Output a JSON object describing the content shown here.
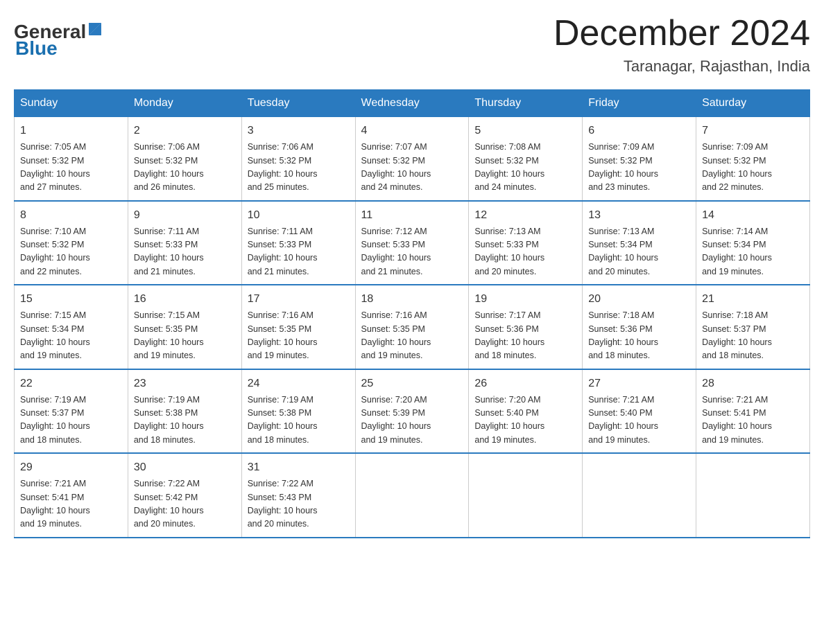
{
  "header": {
    "logo_general": "General",
    "logo_blue": "Blue",
    "month_year": "December 2024",
    "location": "Taranagar, Rajasthan, India"
  },
  "days_of_week": [
    "Sunday",
    "Monday",
    "Tuesday",
    "Wednesday",
    "Thursday",
    "Friday",
    "Saturday"
  ],
  "weeks": [
    [
      {
        "day": "1",
        "sunrise": "7:05 AM",
        "sunset": "5:32 PM",
        "daylight": "10 hours and 27 minutes."
      },
      {
        "day": "2",
        "sunrise": "7:06 AM",
        "sunset": "5:32 PM",
        "daylight": "10 hours and 26 minutes."
      },
      {
        "day": "3",
        "sunrise": "7:06 AM",
        "sunset": "5:32 PM",
        "daylight": "10 hours and 25 minutes."
      },
      {
        "day": "4",
        "sunrise": "7:07 AM",
        "sunset": "5:32 PM",
        "daylight": "10 hours and 24 minutes."
      },
      {
        "day": "5",
        "sunrise": "7:08 AM",
        "sunset": "5:32 PM",
        "daylight": "10 hours and 24 minutes."
      },
      {
        "day": "6",
        "sunrise": "7:09 AM",
        "sunset": "5:32 PM",
        "daylight": "10 hours and 23 minutes."
      },
      {
        "day": "7",
        "sunrise": "7:09 AM",
        "sunset": "5:32 PM",
        "daylight": "10 hours and 22 minutes."
      }
    ],
    [
      {
        "day": "8",
        "sunrise": "7:10 AM",
        "sunset": "5:32 PM",
        "daylight": "10 hours and 22 minutes."
      },
      {
        "day": "9",
        "sunrise": "7:11 AM",
        "sunset": "5:33 PM",
        "daylight": "10 hours and 21 minutes."
      },
      {
        "day": "10",
        "sunrise": "7:11 AM",
        "sunset": "5:33 PM",
        "daylight": "10 hours and 21 minutes."
      },
      {
        "day": "11",
        "sunrise": "7:12 AM",
        "sunset": "5:33 PM",
        "daylight": "10 hours and 21 minutes."
      },
      {
        "day": "12",
        "sunrise": "7:13 AM",
        "sunset": "5:33 PM",
        "daylight": "10 hours and 20 minutes."
      },
      {
        "day": "13",
        "sunrise": "7:13 AM",
        "sunset": "5:34 PM",
        "daylight": "10 hours and 20 minutes."
      },
      {
        "day": "14",
        "sunrise": "7:14 AM",
        "sunset": "5:34 PM",
        "daylight": "10 hours and 19 minutes."
      }
    ],
    [
      {
        "day": "15",
        "sunrise": "7:15 AM",
        "sunset": "5:34 PM",
        "daylight": "10 hours and 19 minutes."
      },
      {
        "day": "16",
        "sunrise": "7:15 AM",
        "sunset": "5:35 PM",
        "daylight": "10 hours and 19 minutes."
      },
      {
        "day": "17",
        "sunrise": "7:16 AM",
        "sunset": "5:35 PM",
        "daylight": "10 hours and 19 minutes."
      },
      {
        "day": "18",
        "sunrise": "7:16 AM",
        "sunset": "5:35 PM",
        "daylight": "10 hours and 19 minutes."
      },
      {
        "day": "19",
        "sunrise": "7:17 AM",
        "sunset": "5:36 PM",
        "daylight": "10 hours and 18 minutes."
      },
      {
        "day": "20",
        "sunrise": "7:18 AM",
        "sunset": "5:36 PM",
        "daylight": "10 hours and 18 minutes."
      },
      {
        "day": "21",
        "sunrise": "7:18 AM",
        "sunset": "5:37 PM",
        "daylight": "10 hours and 18 minutes."
      }
    ],
    [
      {
        "day": "22",
        "sunrise": "7:19 AM",
        "sunset": "5:37 PM",
        "daylight": "10 hours and 18 minutes."
      },
      {
        "day": "23",
        "sunrise": "7:19 AM",
        "sunset": "5:38 PM",
        "daylight": "10 hours and 18 minutes."
      },
      {
        "day": "24",
        "sunrise": "7:19 AM",
        "sunset": "5:38 PM",
        "daylight": "10 hours and 18 minutes."
      },
      {
        "day": "25",
        "sunrise": "7:20 AM",
        "sunset": "5:39 PM",
        "daylight": "10 hours and 19 minutes."
      },
      {
        "day": "26",
        "sunrise": "7:20 AM",
        "sunset": "5:40 PM",
        "daylight": "10 hours and 19 minutes."
      },
      {
        "day": "27",
        "sunrise": "7:21 AM",
        "sunset": "5:40 PM",
        "daylight": "10 hours and 19 minutes."
      },
      {
        "day": "28",
        "sunrise": "7:21 AM",
        "sunset": "5:41 PM",
        "daylight": "10 hours and 19 minutes."
      }
    ],
    [
      {
        "day": "29",
        "sunrise": "7:21 AM",
        "sunset": "5:41 PM",
        "daylight": "10 hours and 19 minutes."
      },
      {
        "day": "30",
        "sunrise": "7:22 AM",
        "sunset": "5:42 PM",
        "daylight": "10 hours and 20 minutes."
      },
      {
        "day": "31",
        "sunrise": "7:22 AM",
        "sunset": "5:43 PM",
        "daylight": "10 hours and 20 minutes."
      },
      null,
      null,
      null,
      null
    ]
  ],
  "labels": {
    "sunrise": "Sunrise:",
    "sunset": "Sunset:",
    "daylight": "Daylight:"
  }
}
